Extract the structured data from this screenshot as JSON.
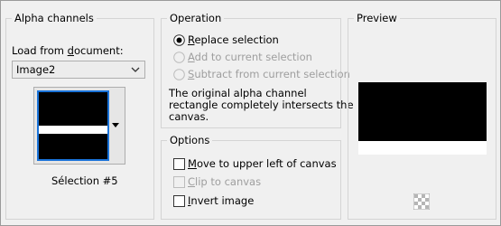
{
  "alpha_channels": {
    "title": "Alpha channels",
    "load_from_document_label": "Load from document:",
    "load_from_document_underline": "d",
    "document_select_value": "Image2",
    "selection_name": "Sélection #5"
  },
  "operation": {
    "title": "Operation",
    "options": [
      {
        "label": "Replace selection",
        "selected": true,
        "enabled": true
      },
      {
        "label": "Add to current selection",
        "selected": false,
        "enabled": false
      },
      {
        "label": "Subtract from current selection",
        "selected": false,
        "enabled": false
      }
    ],
    "info_line1": "The original alpha channel",
    "info_line2": "rectangle completely intersects the",
    "info_line3": "canvas."
  },
  "options": {
    "title": "Options",
    "checkboxes": [
      {
        "label": "Move to upper left of canvas",
        "checked": false,
        "enabled": true
      },
      {
        "label": "Clip to canvas",
        "checked": false,
        "enabled": false
      },
      {
        "label": "Invert image",
        "checked": false,
        "enabled": true
      }
    ]
  },
  "preview": {
    "title": "Preview"
  },
  "colors": {
    "accent": "#1a73d9",
    "disabled_text": "#9e9e9e",
    "background": "#f0f0f0"
  },
  "icons": {
    "dropdown": "chevron-down-icon",
    "thumbnail_dropdown": "triangle-down-icon",
    "transparency": "checkerboard-icon"
  }
}
